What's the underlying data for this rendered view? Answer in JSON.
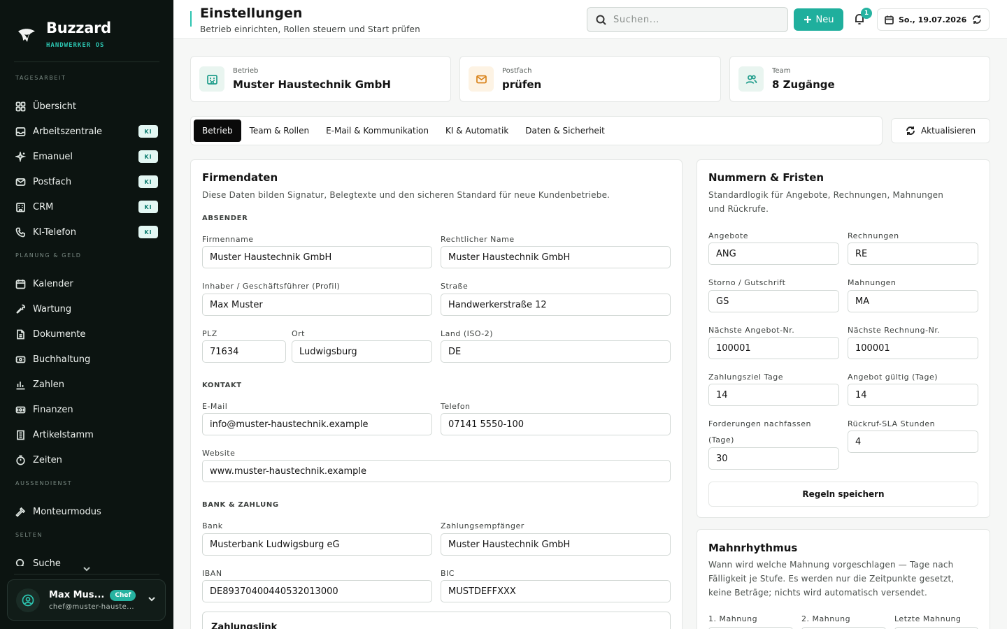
{
  "brand": {
    "name": "Buzzard",
    "sub": "HANDWERKER OS"
  },
  "sidebar": {
    "sections": [
      {
        "title": "TAGESARBEIT",
        "items": [
          {
            "label": "Übersicht",
            "icon": "grid-icon",
            "badge": ""
          },
          {
            "label": "Arbeitszentrale",
            "icon": "inbox-icon",
            "badge": "KI"
          },
          {
            "label": "Emanuel",
            "icon": "sparkles-icon",
            "badge": "KI"
          },
          {
            "label": "Postfach",
            "icon": "mail-icon",
            "badge": "KI"
          },
          {
            "label": "CRM",
            "icon": "building-icon",
            "badge": "KI"
          },
          {
            "label": "KI-Telefon",
            "icon": "phone-icon",
            "badge": "KI"
          }
        ]
      },
      {
        "title": "PLANUNG & GELD",
        "items": [
          {
            "label": "Kalender",
            "icon": "calendar-icon",
            "badge": ""
          },
          {
            "label": "Wartung",
            "icon": "wrench-icon",
            "badge": ""
          },
          {
            "label": "Dokumente",
            "icon": "document-icon",
            "badge": ""
          },
          {
            "label": "Buchhaltung",
            "icon": "receipt-icon",
            "badge": ""
          },
          {
            "label": "Zahlen",
            "icon": "bar-chart-icon",
            "badge": ""
          },
          {
            "label": "Finanzen",
            "icon": "wallet-icon",
            "badge": ""
          },
          {
            "label": "Artikelstamm",
            "icon": "list-icon",
            "badge": ""
          },
          {
            "label": "Zeiten",
            "icon": "timer-icon",
            "badge": ""
          }
        ]
      },
      {
        "title": "AUSSENDIENST",
        "items": [
          {
            "label": "Monteurmodus",
            "icon": "hammer-icon",
            "badge": ""
          }
        ]
      },
      {
        "title": "SELTEN",
        "items": [
          {
            "label": "Suche",
            "icon": "search-icon",
            "badge": ""
          }
        ]
      }
    ]
  },
  "user": {
    "name": "Max Mus...",
    "role": "Chef",
    "email": "chef@muster-hauste..."
  },
  "header": {
    "title": "Einstellungen",
    "subtitle": "Betrieb einrichten, Rollen steuern und Start prüfen",
    "search_placeholder": "Suchen...",
    "new_label": "Neu",
    "notification_count": "1",
    "date": "So., 19.07.2026"
  },
  "summary": [
    {
      "label": "Betrieb",
      "value": "Muster Haustechnik GmbH",
      "icon": "building-icon",
      "tone": "green"
    },
    {
      "label": "Postfach",
      "value": "prüfen",
      "icon": "mail-icon",
      "tone": "orange"
    },
    {
      "label": "Team",
      "value": "8 Zugänge",
      "icon": "users-icon",
      "tone": "green"
    }
  ],
  "tabs": [
    {
      "label": "Betrieb",
      "active": true
    },
    {
      "label": "Team & Rollen",
      "active": false
    },
    {
      "label": "E-Mail & Kommunikation",
      "active": false
    },
    {
      "label": "KI & Automatik",
      "active": false
    },
    {
      "label": "Daten & Sicherheit",
      "active": false
    }
  ],
  "refresh_label": "Aktualisieren",
  "company": {
    "title": "Firmendaten",
    "desc": "Diese Daten bilden Signatur, Belegtexte und den sicheren Standard für neue Kundenbetriebe.",
    "sec_sender": "ABSENDER",
    "sec_contact": "KONTAKT",
    "sec_bank": "BANK & ZAHLUNG",
    "fields": {
      "firmenname": {
        "label": "Firmenname",
        "value": "Muster Haustechnik GmbH"
      },
      "rechtlich": {
        "label": "Rechtlicher Name",
        "value": "Muster Haustechnik GmbH"
      },
      "inhaber": {
        "label": "Inhaber / Geschäftsführer (Profil)",
        "value": "Max Muster"
      },
      "strasse": {
        "label": "Straße",
        "value": "Handwerkerstraße 12"
      },
      "plz": {
        "label": "PLZ",
        "value": "71634"
      },
      "ort": {
        "label": "Ort",
        "value": "Ludwigsburg"
      },
      "land": {
        "label": "Land (ISO-2)",
        "value": "DE"
      },
      "email": {
        "label": "E-Mail",
        "value": "info@muster-haustechnik.example"
      },
      "telefon": {
        "label": "Telefon",
        "value": "07141 5550-100"
      },
      "website": {
        "label": "Website",
        "value": "www.muster-haustechnik.example"
      },
      "bank": {
        "label": "Bank",
        "value": "Musterbank Ludwigsburg eG"
      },
      "empfaenger": {
        "label": "Zahlungsempfänger",
        "value": "Muster Haustechnik GmbH"
      },
      "iban": {
        "label": "IBAN",
        "value": "DE89370400440532013000"
      },
      "bic": {
        "label": "BIC",
        "value": "MUSTDEFFXXX"
      }
    },
    "payment_link_title": "Zahlungslink"
  },
  "numbers": {
    "title": "Nummern & Fristen",
    "desc_line1": "Standardlogik für Angebote, Rechnungen, Mahnungen",
    "desc_line2": "und Rückrufe.",
    "fields": {
      "angebote": {
        "label": "Angebote",
        "value": "ANG"
      },
      "rechnungen": {
        "label": "Rechnungen",
        "value": "RE"
      },
      "storno": {
        "label": "Storno / Gutschrift",
        "value": "GS"
      },
      "mahnungen": {
        "label": "Mahnungen",
        "value": "MA"
      },
      "next_angebot": {
        "label": "Nächste Angebot-Nr.",
        "value": "100001"
      },
      "next_rechnung": {
        "label": "Nächste Rechnung-Nr.",
        "value": "100001"
      },
      "zahlungsziel": {
        "label": "Zahlungsziel Tage",
        "value": "14"
      },
      "angebot_gueltig": {
        "label": "Angebot gültig (Tage)",
        "value": "14"
      },
      "forderungen_l1": "Forderungen nachfassen",
      "forderungen_l2": "(Tage)",
      "forderungen": {
        "value": "30"
      },
      "rueckruf": {
        "label": "Rückruf-SLA Stunden",
        "value": "4"
      }
    },
    "save_label": "Regeln speichern"
  },
  "dunning": {
    "title": "Mahnrhythmus",
    "desc_line1": "Wann wird welche Mahnung vorgeschlagen — Tage nach",
    "desc_line2": "Fälligkeit je Stufe. Es werden nur die Zeitpunkte gesetzt,",
    "desc_line3": "keine Beträge; nichts wird automatisch versendet.",
    "labels": [
      "1. Mahnung",
      "2. Mahnung",
      "Letzte Mahnung"
    ]
  }
}
